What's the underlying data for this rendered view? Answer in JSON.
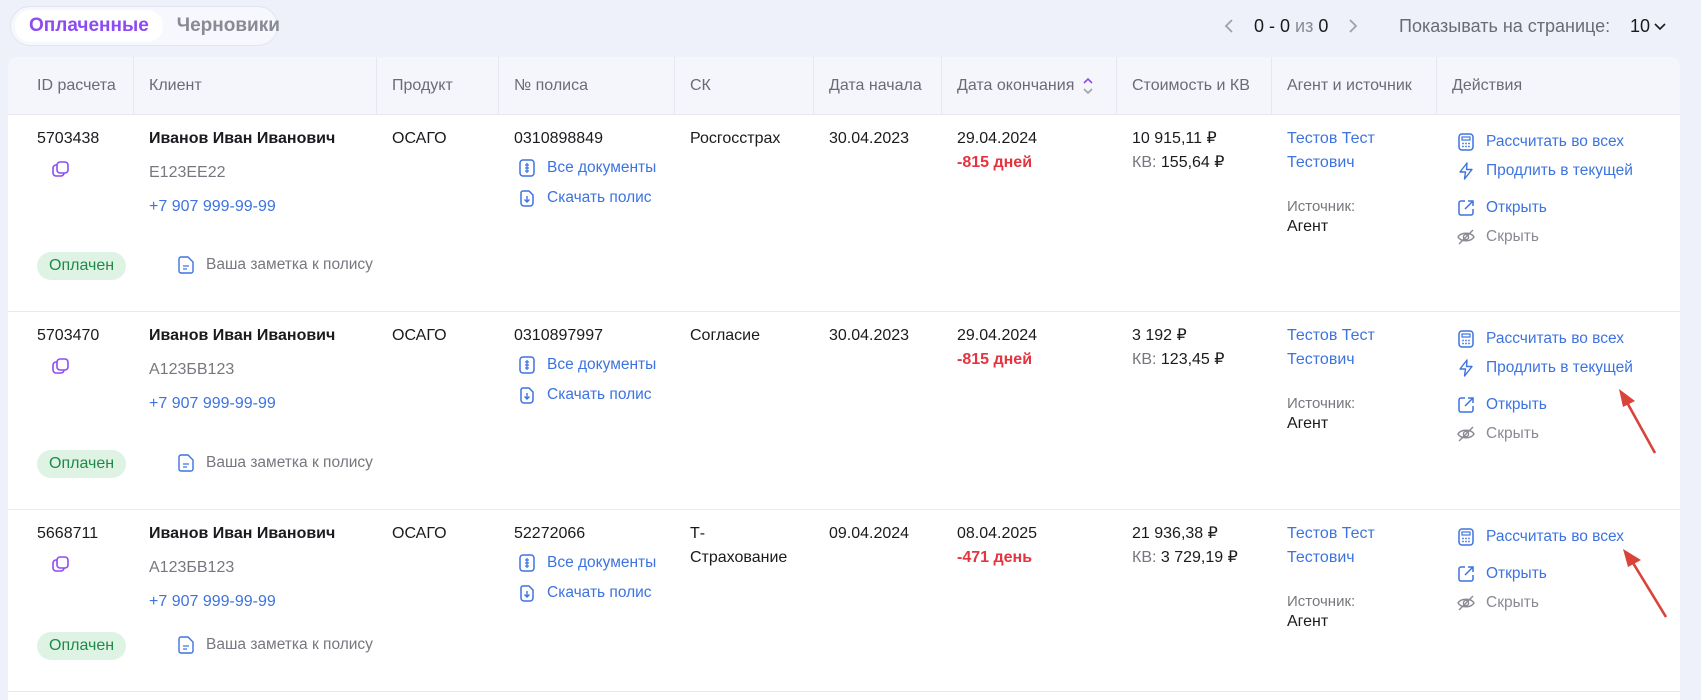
{
  "tabs": [
    {
      "label": "Оплаченные",
      "active": true
    },
    {
      "label": "Черновики",
      "active": false
    }
  ],
  "pagination": {
    "range": "0 - 0",
    "of_label": "из",
    "total": "0",
    "per_page_label": "Показывать на странице:",
    "per_page_value": "10"
  },
  "columns": [
    "ID расчета",
    "Клиент",
    "Продукт",
    "№ полиса",
    "СК",
    "Дата начала",
    "Дата окончания",
    "Стоимость и КВ",
    "Агент и источник",
    "Действия"
  ],
  "labels": {
    "all_docs": "Все документы",
    "download_policy": "Скачать полис",
    "kv_prefix": "КВ:",
    "source_label": "Источник:",
    "note": "Ваша заметка к полису",
    "calc_all": "Рассчитать во всех",
    "extend_current": "Продлить в текущей",
    "open": "Открыть",
    "hide": "Скрыть"
  },
  "rows": [
    {
      "id": "5703438",
      "client_name": "Иванов Иван Иванович",
      "plate": "Е123ЕЕ22",
      "phone": "+7 907 999-99-99",
      "product": "ОСАГО",
      "policy": "0310898849",
      "insurer": "Росгосстрах",
      "start_date": "30.04.2023",
      "end_date": "29.04.2024",
      "days_left": "-815 дней",
      "price": "10 915,11 ₽",
      "kv": "155,64 ₽",
      "agent": "Тестов Тест Тестович",
      "source": "Агент",
      "status": "Оплачен"
    },
    {
      "id": "5703470",
      "client_name": "Иванов Иван Иванович",
      "plate": "А123БВ123",
      "phone": "+7 907 999-99-99",
      "product": "ОСАГО",
      "policy": "0310897997",
      "insurer": "Согласие",
      "start_date": "30.04.2023",
      "end_date": "29.04.2024",
      "days_left": "-815 дней",
      "price": "3 192 ₽",
      "kv": "123,45 ₽",
      "agent": "Тестов Тест Тестович",
      "source": "Агент",
      "status": "Оплачен"
    },
    {
      "id": "5668711",
      "client_name": "Иванов Иван Иванович",
      "plate": "А123БВ123",
      "phone": "+7 907 999-99-99",
      "product": "ОСАГО",
      "policy": "52272066",
      "insurer": "Т-Страхование",
      "start_date": "09.04.2024",
      "end_date": "08.04.2025",
      "days_left": "-471 день",
      "price": "21 936,38 ₽",
      "kv": "3 729,19 ₽",
      "agent": "Тестов Тест Тестович",
      "source": "Агент",
      "status": "Оплачен"
    }
  ],
  "colors": {
    "accent": "#8c4cf2",
    "link": "#3d73e0",
    "danger": "#e5333f",
    "status_bg": "#def3e4",
    "status_text": "#1f8a47",
    "annotation_arrow": "#d9433a"
  },
  "icons": [
    "chevron-left-icon",
    "chevron-right-icon",
    "chevron-down-icon",
    "sort-icon",
    "copy-icon",
    "document-icon",
    "download-icon",
    "note-icon",
    "calculator-icon",
    "lightning-icon",
    "external-link-icon",
    "eye-off-icon"
  ]
}
